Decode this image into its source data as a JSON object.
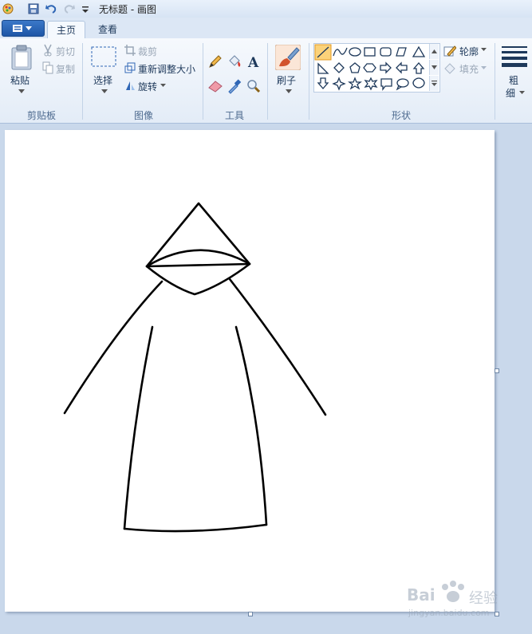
{
  "window": {
    "title": "无标题 - 画图"
  },
  "tabs": [
    {
      "label": "主页",
      "active": true
    },
    {
      "label": "查看",
      "active": false
    }
  ],
  "clipboard": {
    "paste": "粘贴",
    "cut": "剪切",
    "copy": "复制",
    "group": "剪贴板"
  },
  "image": {
    "select": "选择",
    "crop": "裁剪",
    "resize": "重新调整大小",
    "rotate": "旋转",
    "group": "图像"
  },
  "tools": {
    "group": "工具"
  },
  "brushes": {
    "label": "刷子"
  },
  "shapes": {
    "group": "形状",
    "outline": "轮廓",
    "fill": "填充"
  },
  "size": {
    "label_line1": "粗",
    "label_line2": "细"
  },
  "watermark": {
    "brand_a": "Bai",
    "brand_b": "经验",
    "url": "jingyan.baidu.com"
  },
  "colors": {
    "accent": "#2f66b5",
    "ribbon": "#e3ecf7",
    "canvas_bg": "#c9d8eb"
  }
}
